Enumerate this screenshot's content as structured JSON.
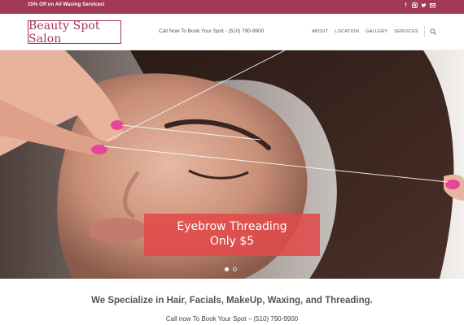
{
  "topbar": {
    "promo": "15% Off on All Waxing Services!",
    "social_icons": [
      "facebook-icon",
      "instagram-icon",
      "twitter-icon",
      "email-icon"
    ],
    "background": "#a23a55"
  },
  "header": {
    "logo_text": "Beauty Spot Salon",
    "call_text": "Call Now To Book Your Spot - (510) 790-9900",
    "nav": [
      "ABOUT",
      "LOCATION",
      "GALLERY",
      "SERVICES"
    ],
    "search_icon": "search-icon",
    "accent": "#a23a55"
  },
  "hero": {
    "caption_line1": "Eyebrow Threading",
    "caption_line2": "Only $5",
    "caption_color": "#e04a4a",
    "slides_total": 2,
    "slide_active": 1
  },
  "main": {
    "specialize": "We Specialize in Hair, Facials, MakeUp, Waxing, and Threading.",
    "call_line": "Call now To Book Your Spot – (510) 790-9900"
  }
}
